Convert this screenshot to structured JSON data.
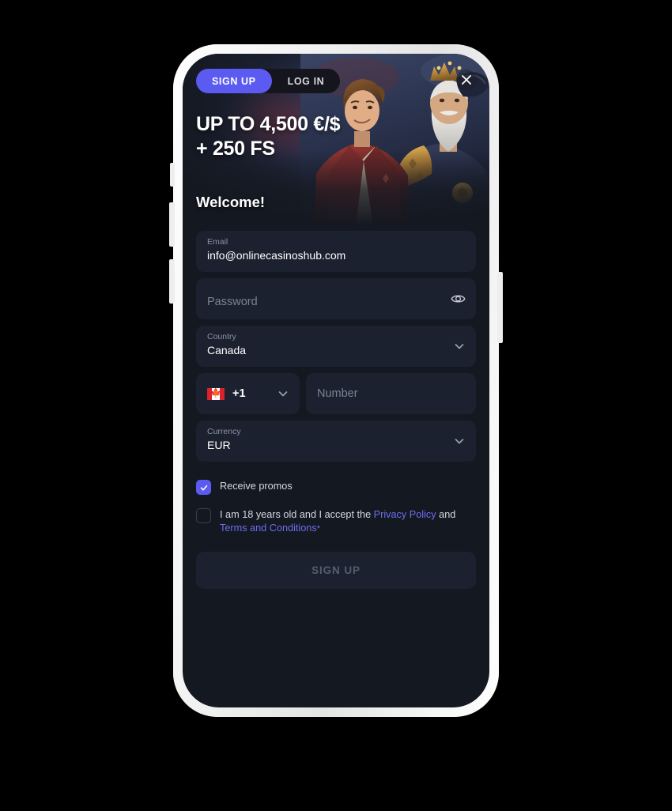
{
  "banner": {
    "tabs": [
      {
        "label": "SIGN UP",
        "active": true
      },
      {
        "label": "LOG IN",
        "active": false
      }
    ],
    "close_icon": "close-icon",
    "offer_line1": "UP TO 4,500 €/$",
    "offer_line2": "+ 250 FS",
    "welcome": "Welcome!"
  },
  "form": {
    "email": {
      "label": "Email",
      "value": "info@onlinecasinoshub.com"
    },
    "password": {
      "placeholder": "Password",
      "value": "",
      "toggle_icon": "eye-icon"
    },
    "country": {
      "label": "Country",
      "value": "Canada",
      "chevron_icon": "chevron-down-icon"
    },
    "phone": {
      "country_code": "+1",
      "flag": "canada-flag",
      "chevron_icon": "chevron-down-icon",
      "number_placeholder": "Number",
      "number_value": ""
    },
    "currency": {
      "label": "Currency",
      "value": "EUR",
      "chevron_icon": "chevron-down-icon"
    }
  },
  "consents": {
    "promos": {
      "label": "Receive promos",
      "checked": true
    },
    "age_terms": {
      "text_before": "I am 18 years old and I accept the ",
      "privacy_link": "Privacy Policy",
      "text_middle": " and ",
      "terms_link": "Terms and Conditions",
      "required_mark": "*",
      "checked": false
    }
  },
  "submit": {
    "label": "SIGN UP",
    "enabled": false
  },
  "colors": {
    "page_bg": "#141820",
    "field_bg": "#1c2130",
    "accent": "#5b5bf2",
    "link": "#6e6ef0",
    "label_text": "#8b92a3",
    "placeholder_text": "#7b8292",
    "disabled_text": "#555c6d",
    "frame": "#f2f2f2"
  }
}
